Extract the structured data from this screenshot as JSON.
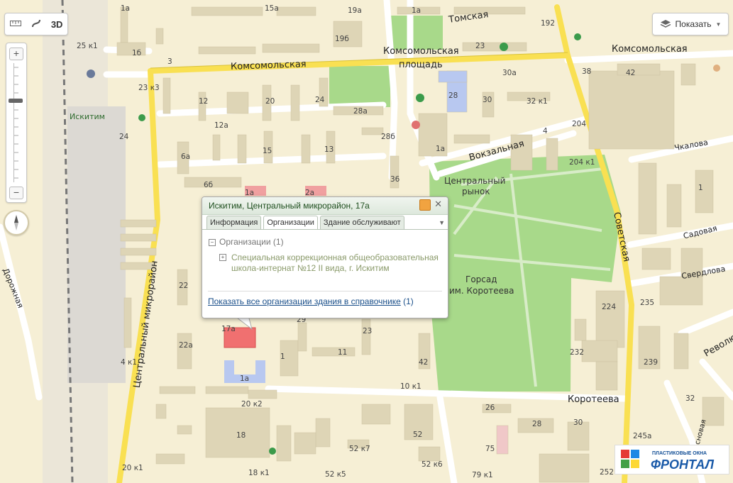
{
  "toolbar": {
    "ruler_icon": "ruler-icon",
    "traffic_icon": "route-icon",
    "btn_3d": "3D"
  },
  "layers": {
    "label": "Показать",
    "icon": "layers-icon"
  },
  "zoom": {
    "plus": "+",
    "minus": "−"
  },
  "popup": {
    "title": "Искитим, Центральный микрорайон, 17а",
    "tabs": [
      "Информация",
      "Организации",
      "Здание обслуживают"
    ],
    "active_tab": "Организации",
    "orgs_header": "Организации (1)",
    "org_name": "Специальная коррекционная общеобразовательная школа-интернат №12 II вида, г. Искитим",
    "show_all_link": "Показать все организации здания в справочнике",
    "show_all_count": "(1)"
  },
  "map": {
    "streets": {
      "komsomolskaya_w": "Комсомольская",
      "komsomolskaya_c": "Комсомольская",
      "komsomolskaya_e": "Комсомольская",
      "ploshchad": "площадь",
      "tomskaya": "Томская",
      "vokzalnaya": "Вокзальная",
      "tsentralny_mkr": "Центральный микрорайон",
      "sovetskaya": "Советская",
      "koroteeva": "Коротеева",
      "dorozhnaya": "Дорожная",
      "sadovaya": "Садовая",
      "sverdlova": "Свердлова",
      "chkalova": "Чкалова",
      "revolyutsii": "Революции",
      "sosnovaya": "Сосновая"
    },
    "places": {
      "iskitim": "Искитим",
      "market_1": "Центральный",
      "market_2": "рынок",
      "gorsad_1": "Горсад",
      "gorsad_2": "им. Коротеева"
    },
    "numbers": [
      "1а",
      "15а",
      "19а",
      "1а",
      "192",
      "25 к1",
      "1б",
      "3",
      "19б",
      "23",
      "30а",
      "38",
      "42",
      "23 к3",
      "12",
      "20",
      "24",
      "28",
      "28а",
      "30",
      "32 к1",
      "24",
      "12а",
      "28б",
      "4",
      "204",
      "6а",
      "15",
      "13",
      "36",
      "1а",
      "204 к1",
      "6б",
      "1",
      "1а",
      "2а",
      "22",
      "22а",
      "23",
      "11",
      "42",
      "224",
      "232",
      "235",
      "239",
      "4 к1",
      "17а",
      "1а",
      "1",
      "10 к1",
      "20 к2",
      "26",
      "28",
      "30",
      "245а",
      "18",
      "52",
      "52 к7",
      "75",
      "20 к1",
      "18 к1",
      "52 к5",
      "52 к6",
      "79 к1",
      "252",
      "32",
      "29"
    ],
    "colors": {
      "land": "#f6efd5",
      "road": "#ffffff",
      "major_road": "#f9e052",
      "park": "#a8d98a",
      "building": "#ded5b6",
      "highlight": "#f07070"
    }
  },
  "brand": {
    "top": "ПЛАСТИКОВЫЕ ОКНА",
    "name": "ФРОНТАЛ"
  }
}
